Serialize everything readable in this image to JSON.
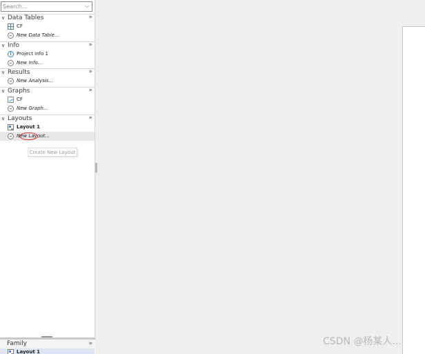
{
  "search": {
    "placeholder": "Search...",
    "dropdown_icon": "chevron-down-icon"
  },
  "sections": {
    "data_tables": {
      "title": "Data Tables",
      "items": [
        {
          "label": "CF",
          "icon": "table-icon"
        },
        {
          "label": "New Data Table...",
          "icon": "new-item-icon"
        }
      ]
    },
    "info": {
      "title": "Info",
      "items": [
        {
          "label": "Project info 1",
          "icon": "info-icon"
        },
        {
          "label": "New Info...",
          "icon": "new-item-icon"
        }
      ]
    },
    "results": {
      "title": "Results",
      "items": [
        {
          "label": "New Analysis...",
          "icon": "new-item-icon"
        }
      ]
    },
    "graphs": {
      "title": "Graphs",
      "items": [
        {
          "label": "CF",
          "icon": "graph-icon"
        },
        {
          "label": "New Graph...",
          "icon": "new-item-icon"
        }
      ]
    },
    "layouts": {
      "title": "Layouts",
      "items": [
        {
          "label": "Layout 1",
          "icon": "layout-icon"
        },
        {
          "label": "New Layout...",
          "icon": "new-item-icon"
        }
      ]
    }
  },
  "tooltip": {
    "text": "Create New Layout"
  },
  "family": {
    "title": "Family",
    "items": [
      {
        "label": "Layout 1",
        "icon": "layout-icon"
      }
    ]
  },
  "watermark": "CSDN @杨某人...",
  "colors": {
    "highlight_circle": "#d23b3b",
    "info_accent": "#3f78c8",
    "family_selected_bg": "#dde7f4"
  }
}
